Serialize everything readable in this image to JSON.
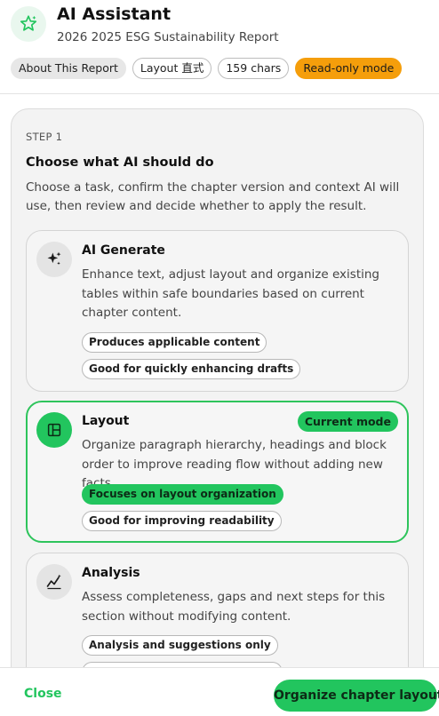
{
  "header": {
    "title": "AI Assistant",
    "subtitle": "2026 2025 ESG Sustainability Report",
    "icon": "sparkle-star-icon",
    "chips": [
      {
        "label": "About This Report",
        "style": "grey"
      },
      {
        "label": "Layout 直式",
        "style": "outline"
      },
      {
        "label": "159 chars",
        "style": "outline"
      },
      {
        "label": "Read-only mode",
        "style": "orange"
      }
    ]
  },
  "step": {
    "label": "STEP 1",
    "title": "Choose what AI should do",
    "description": "Choose a task, confirm the chapter version and context AI will use, then review and decide whether to apply the result."
  },
  "options": [
    {
      "icon": "sparkles-icon",
      "title": "AI Generate",
      "description": "Enhance text, adjust layout and organize existing tables within safe boundaries based on current chapter content.",
      "tags": [
        "Produces applicable content",
        "Good for quickly enhancing drafts"
      ],
      "active": false
    },
    {
      "icon": "layout-icon",
      "title": "Layout",
      "badge": "Current mode",
      "description": "Organize paragraph hierarchy, headings and block order to improve reading flow without adding new facts.",
      "tags": [
        "Focuses on layout organization",
        "Good for improving readability"
      ],
      "active": true
    },
    {
      "icon": "trend-analysis-icon",
      "title": "Analysis",
      "description": "Assess completeness, gaps and next steps for this section without modifying content.",
      "tags": [
        "Analysis and suggestions only"
      ],
      "active": false
    }
  ],
  "footer": {
    "close_label": "Close",
    "primary_label": "Organize chapter layout"
  },
  "colors": {
    "accent": "#22c55e",
    "warning": "#f59e0b",
    "panel": "#f3f3f3"
  }
}
